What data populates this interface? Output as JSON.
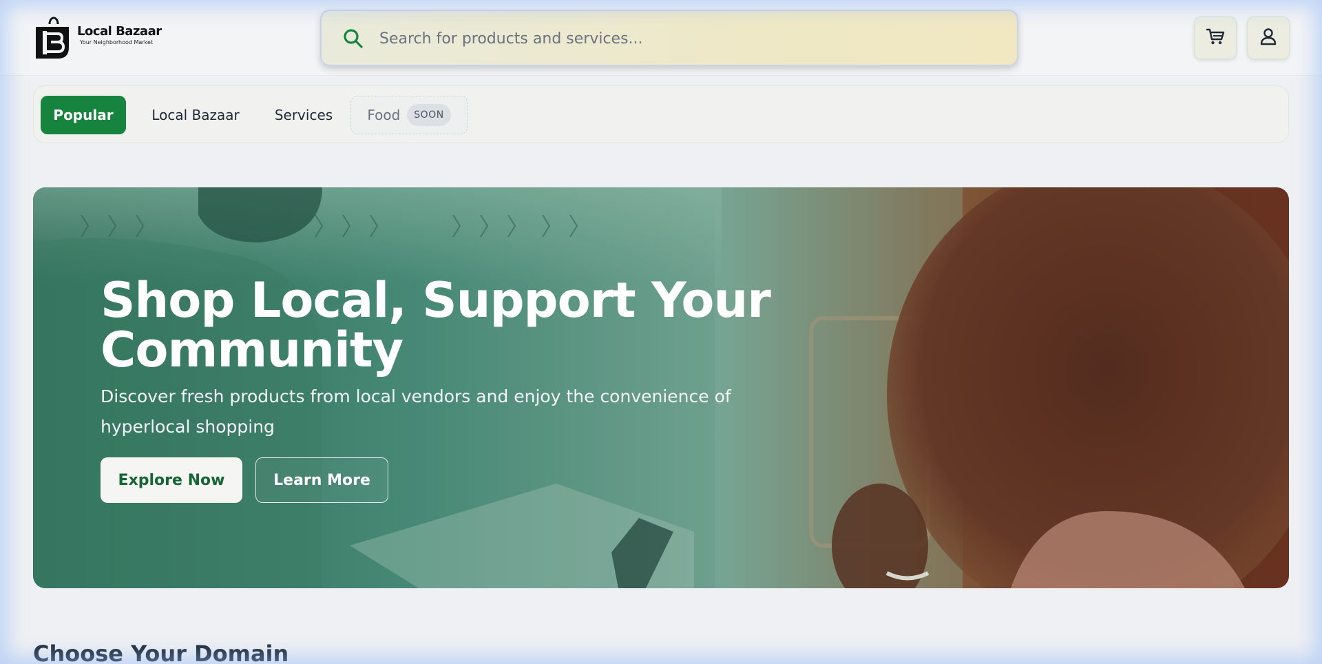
{
  "brand": {
    "name": "Local Bazaar",
    "tagline": "Your Neighborhood Market"
  },
  "search": {
    "placeholder": "Search for products and services..."
  },
  "header": {
    "cart_icon": "cart-icon",
    "user_icon": "user-icon"
  },
  "tabs": [
    {
      "label": "Popular",
      "active": true
    },
    {
      "label": "Local Bazaar",
      "active": false
    },
    {
      "label": "Services",
      "active": false
    },
    {
      "label": "Food",
      "active": false,
      "badge": "SOON"
    }
  ],
  "hero": {
    "title_line1": "Shop Local, Support Your",
    "title_line2": "Community",
    "subtitle_line1": "Discover fresh products from local vendors and enjoy the convenience of",
    "subtitle_line2": "hyperlocal shopping",
    "primary_button": "Explore Now",
    "secondary_button": "Learn More"
  },
  "sections": {
    "domain_heading": "Choose Your Domain"
  },
  "colors": {
    "accent": "#16833f",
    "search_icon": "#16833f",
    "hero_overlay_left": "#2f6e5a",
    "hero_overlay_right": "#722b1a"
  }
}
